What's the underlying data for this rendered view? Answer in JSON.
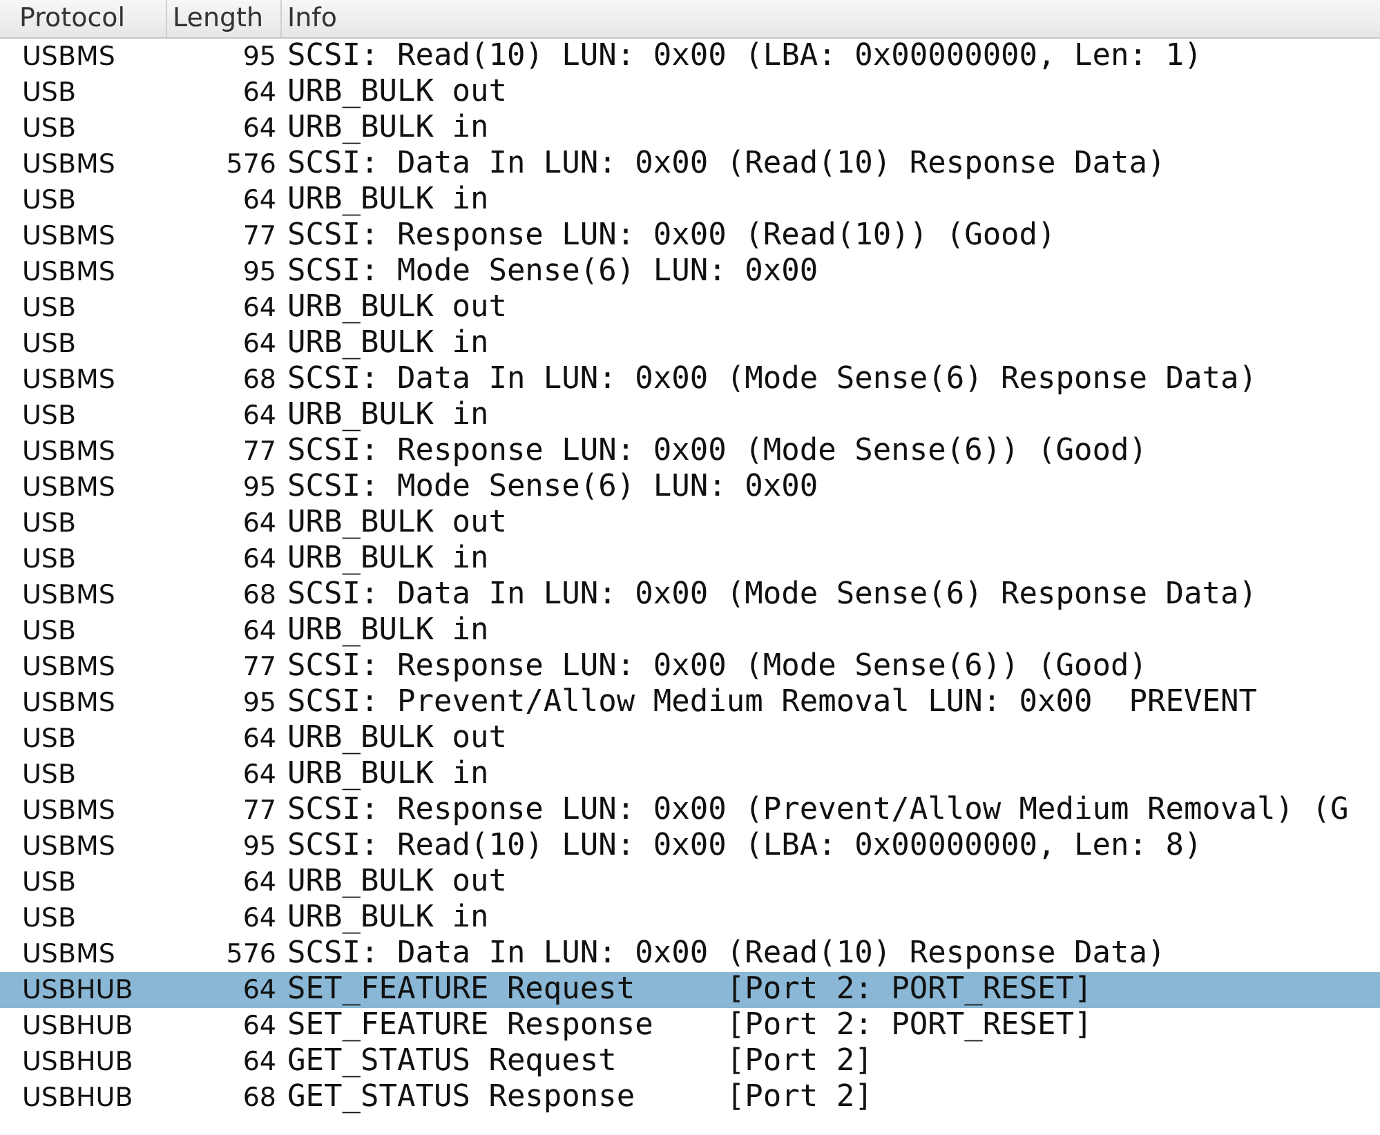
{
  "columns": [
    {
      "label": "Protocol"
    },
    {
      "label": "Length"
    },
    {
      "label": "Info"
    }
  ],
  "rows": [
    {
      "protocol": "USBMS",
      "length": "95",
      "info": "SCSI: Read(10) LUN: 0x00 (LBA: 0x00000000, Len: 1)",
      "selected": false
    },
    {
      "protocol": "USB",
      "length": "64",
      "info": "URB_BULK out",
      "selected": false
    },
    {
      "protocol": "USB",
      "length": "64",
      "info": "URB_BULK in",
      "selected": false
    },
    {
      "protocol": "USBMS",
      "length": "576",
      "info": "SCSI: Data In LUN: 0x00 (Read(10) Response Data)",
      "selected": false
    },
    {
      "protocol": "USB",
      "length": "64",
      "info": "URB_BULK in",
      "selected": false
    },
    {
      "protocol": "USBMS",
      "length": "77",
      "info": "SCSI: Response LUN: 0x00 (Read(10)) (Good)",
      "selected": false
    },
    {
      "protocol": "USBMS",
      "length": "95",
      "info": "SCSI: Mode Sense(6) LUN: 0x00",
      "selected": false
    },
    {
      "protocol": "USB",
      "length": "64",
      "info": "URB_BULK out",
      "selected": false
    },
    {
      "protocol": "USB",
      "length": "64",
      "info": "URB_BULK in",
      "selected": false
    },
    {
      "protocol": "USBMS",
      "length": "68",
      "info": "SCSI: Data In LUN: 0x00 (Mode Sense(6) Response Data)",
      "selected": false
    },
    {
      "protocol": "USB",
      "length": "64",
      "info": "URB_BULK in",
      "selected": false
    },
    {
      "protocol": "USBMS",
      "length": "77",
      "info": "SCSI: Response LUN: 0x00 (Mode Sense(6)) (Good)",
      "selected": false
    },
    {
      "protocol": "USBMS",
      "length": "95",
      "info": "SCSI: Mode Sense(6) LUN: 0x00",
      "selected": false
    },
    {
      "protocol": "USB",
      "length": "64",
      "info": "URB_BULK out",
      "selected": false
    },
    {
      "protocol": "USB",
      "length": "64",
      "info": "URB_BULK in",
      "selected": false
    },
    {
      "protocol": "USBMS",
      "length": "68",
      "info": "SCSI: Data In LUN: 0x00 (Mode Sense(6) Response Data)",
      "selected": false
    },
    {
      "protocol": "USB",
      "length": "64",
      "info": "URB_BULK in",
      "selected": false
    },
    {
      "protocol": "USBMS",
      "length": "77",
      "info": "SCSI: Response LUN: 0x00 (Mode Sense(6)) (Good)",
      "selected": false
    },
    {
      "protocol": "USBMS",
      "length": "95",
      "info": "SCSI: Prevent/Allow Medium Removal LUN: 0x00  PREVENT",
      "selected": false
    },
    {
      "protocol": "USB",
      "length": "64",
      "info": "URB_BULK out",
      "selected": false
    },
    {
      "protocol": "USB",
      "length": "64",
      "info": "URB_BULK in",
      "selected": false
    },
    {
      "protocol": "USBMS",
      "length": "77",
      "info": "SCSI: Response LUN: 0x00 (Prevent/Allow Medium Removal) (G",
      "selected": false
    },
    {
      "protocol": "USBMS",
      "length": "95",
      "info": "SCSI: Read(10) LUN: 0x00 (LBA: 0x00000000, Len: 8)",
      "selected": false
    },
    {
      "protocol": "USB",
      "length": "64",
      "info": "URB_BULK out",
      "selected": false
    },
    {
      "protocol": "USB",
      "length": "64",
      "info": "URB_BULK in",
      "selected": false
    },
    {
      "protocol": "USBMS",
      "length": "576",
      "info": "SCSI: Data In LUN: 0x00 (Read(10) Response Data)",
      "selected": false
    },
    {
      "protocol": "USBHUB",
      "length": "64",
      "info": "SET_FEATURE Request     [Port 2: PORT_RESET]",
      "selected": true
    },
    {
      "protocol": "USBHUB",
      "length": "64",
      "info": "SET_FEATURE Response    [Port 2: PORT_RESET]",
      "selected": false
    },
    {
      "protocol": "USBHUB",
      "length": "64",
      "info": "GET_STATUS Request      [Port 2]",
      "selected": false
    },
    {
      "protocol": "USBHUB",
      "length": "68",
      "info": "GET_STATUS Response     [Port 2]",
      "selected": false
    }
  ]
}
